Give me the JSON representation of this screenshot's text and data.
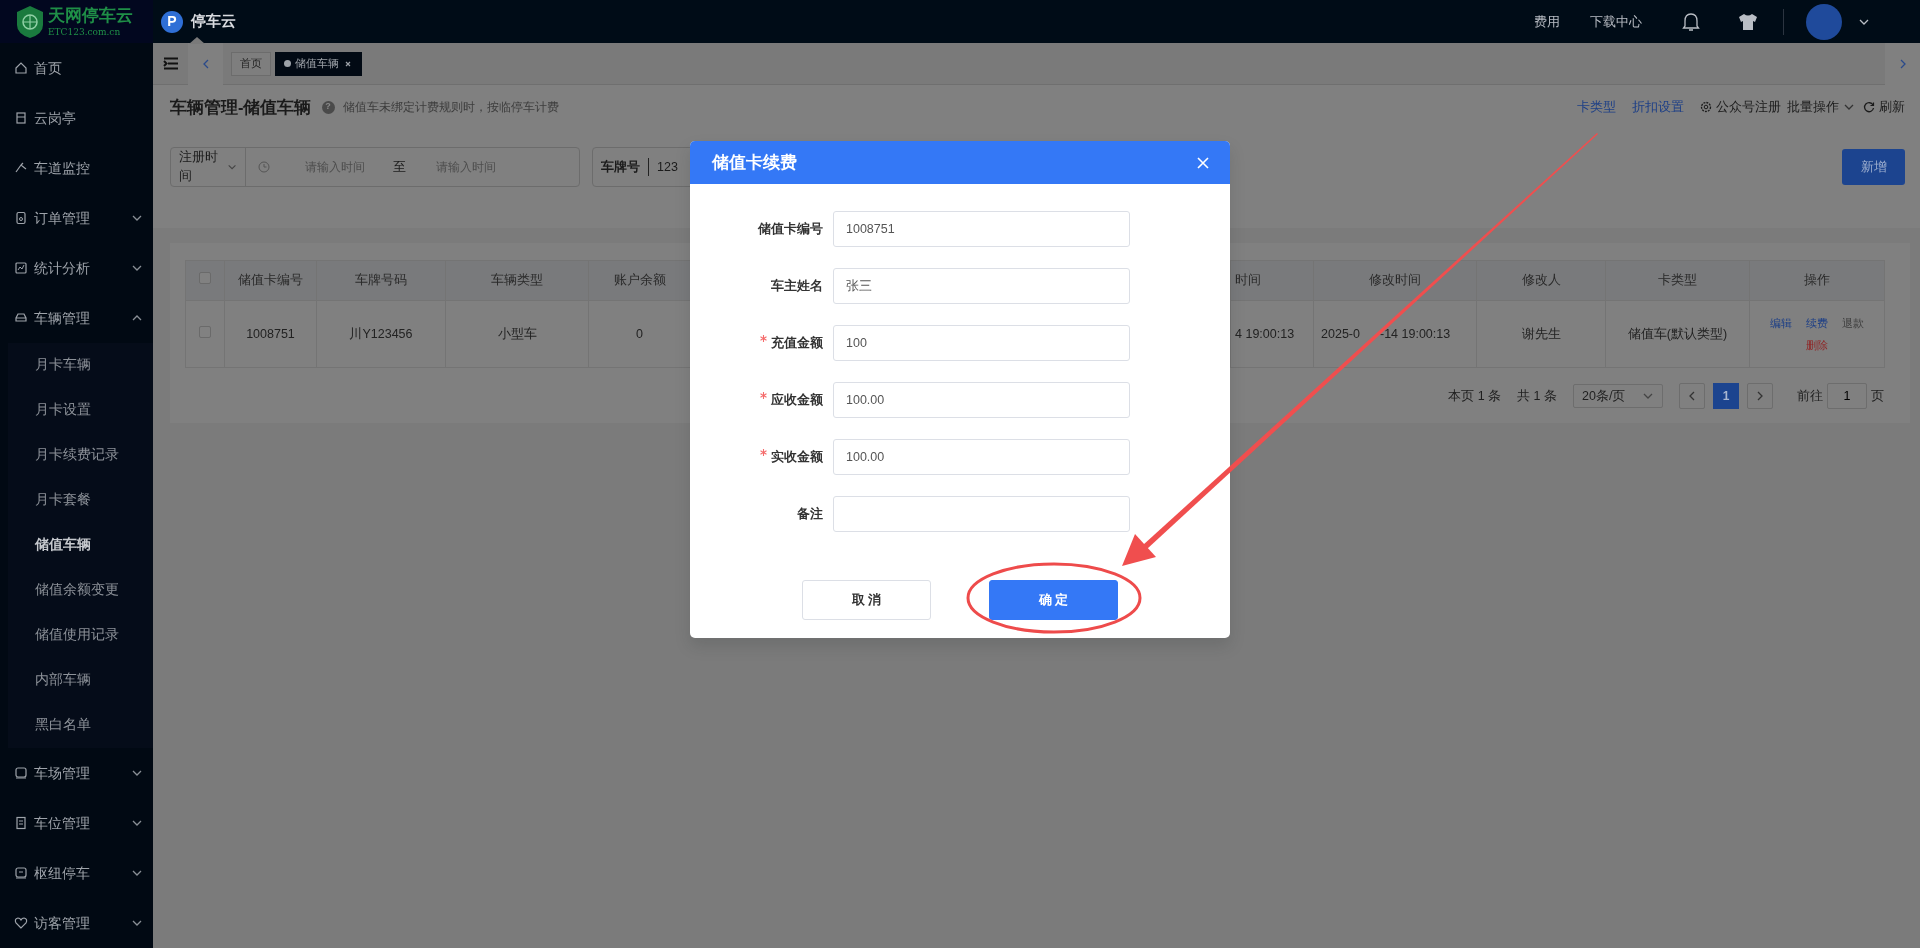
{
  "header": {
    "logo": {
      "name": "天网停车云",
      "domain": "ETC123.com.cn"
    },
    "app_icon": "P",
    "app": "停车云",
    "links": [
      "费用",
      "下载中心"
    ]
  },
  "sidebar": {
    "items": [
      {
        "label": "首页"
      },
      {
        "label": "云岗亭"
      },
      {
        "label": "车道监控"
      },
      {
        "label": "订单管理",
        "expanded": false
      },
      {
        "label": "统计分析",
        "expanded": false
      },
      {
        "label": "车辆管理",
        "expanded": true,
        "children": [
          {
            "label": "月卡车辆",
            "selected": false
          },
          {
            "label": "月卡设置",
            "selected": false
          },
          {
            "label": "月卡续费记录",
            "selected": false
          },
          {
            "label": "月卡套餐",
            "selected": false
          },
          {
            "label": "储值车辆",
            "selected": true
          },
          {
            "label": "储值余额变更",
            "selected": false
          },
          {
            "label": "储值使用记录",
            "selected": false
          },
          {
            "label": "内部车辆",
            "selected": false
          },
          {
            "label": "黑白名单",
            "selected": false
          }
        ]
      },
      {
        "label": "车场管理",
        "expanded": false
      },
      {
        "label": "车位管理",
        "expanded": false
      },
      {
        "label": "枢纽停车",
        "expanded": false
      },
      {
        "label": "访客管理",
        "expanded": false
      }
    ]
  },
  "tabs": [
    {
      "label": "首页",
      "selected": false
    },
    {
      "label": "储值车辆",
      "selected": true
    }
  ],
  "page": {
    "title": "车辆管理-储值车辆",
    "help_mark": "?",
    "hint": "储值车未绑定计费规则时，按临停车计费",
    "actions": [
      {
        "label": "卡类型",
        "kind": "link"
      },
      {
        "label": "折扣设置",
        "kind": "link"
      },
      {
        "label": "公众号注册",
        "kind": "gear"
      },
      {
        "label": "批量操作",
        "kind": "dropdown"
      },
      {
        "label": "刷新",
        "kind": "refresh"
      }
    ]
  },
  "filters": {
    "date_type": "注册时间",
    "start_placeholder": "请输入时间",
    "separator": "至",
    "end_placeholder": "请输入时间",
    "plate_label": "车牌号",
    "plate_value": "123"
  },
  "add_button": "新增",
  "table": {
    "select_all": {
      "checked": false
    },
    "columns": [
      "储值卡编号",
      "车牌号码",
      "车辆类型",
      "账户余额",
      "时间",
      "修改时间",
      "修改人",
      "卡类型",
      "操作"
    ],
    "rows": [
      {
        "checked": false,
        "cells": [
          "1008751",
          "川Y123456",
          "小型车",
          "0",
          "4 19:00:13",
          [
            "2025-0",
            "-14 19:00:13"
          ],
          "谢先生",
          "储值车(默认类型)"
        ],
        "actions": [
          {
            "label": "编辑",
            "kind": "link"
          },
          {
            "label": "续费",
            "kind": "link"
          },
          {
            "label": "退款",
            "kind": "muted"
          },
          {
            "label": "删除",
            "kind": "danger"
          }
        ]
      }
    ]
  },
  "pagination": {
    "page_text": "本页 1 条",
    "total_text": "共 1 条",
    "page_size": "20条/页",
    "pages": [
      {
        "label": "1",
        "selected": true
      }
    ],
    "goto_label": "前往",
    "goto_value": "1",
    "goto_suffix": "页"
  },
  "modal": {
    "title": "储值卡续费",
    "fields": [
      {
        "label": "储值卡编号",
        "value": "1008751",
        "required": false
      },
      {
        "label": "车主姓名",
        "value": "张三",
        "required": false
      },
      {
        "label": "充值金额",
        "value": "100",
        "required": true
      },
      {
        "label": "应收金额",
        "value": "100.00",
        "required": true
      },
      {
        "label": "实收金额",
        "value": "100.00",
        "required": true
      },
      {
        "label": "备注",
        "required": false
      }
    ],
    "buttons": [
      {
        "label": "取 消",
        "kind": "secondary"
      },
      {
        "label": "确 定",
        "kind": "primary"
      }
    ]
  }
}
